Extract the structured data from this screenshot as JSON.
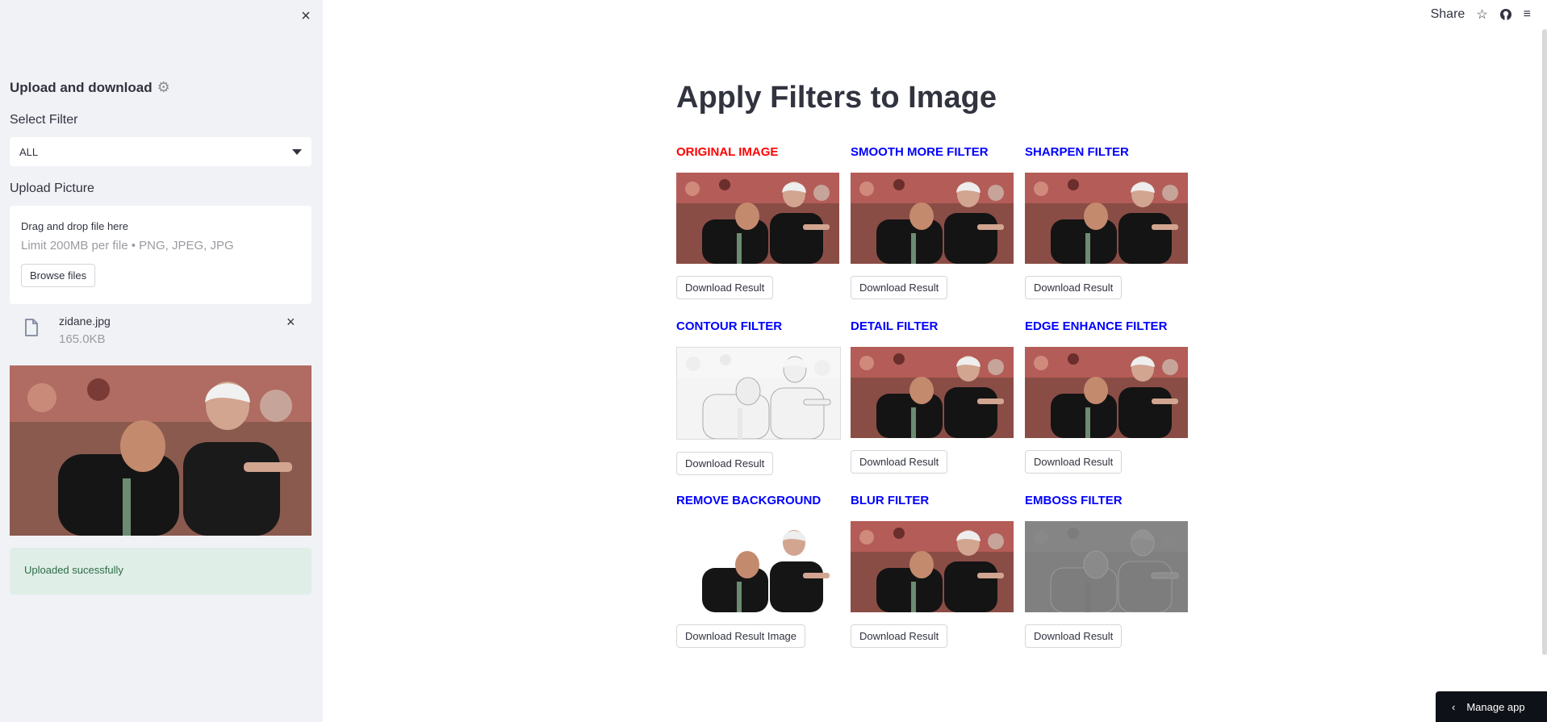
{
  "sidebar": {
    "close_icon": "×",
    "heading": "Upload and download",
    "gear_icon": "⚙",
    "select_label": "Select Filter",
    "select_value": "ALL",
    "upload_label": "Upload Picture",
    "dropzone_title": "Drag and drop file here",
    "dropzone_limit": "Limit 200MB per file • PNG, JPEG, JPG",
    "browse_label": "Browse files",
    "file_name": "zidane.jpg",
    "file_size": "165.0KB",
    "remove_icon": "×",
    "success_text": "Uploaded sucessfully"
  },
  "toolbar": {
    "share_label": "Share",
    "star_icon": "☆",
    "github_icon": "github-icon",
    "menu_icon": "≡"
  },
  "main": {
    "title": "Apply Filters to Image",
    "filters": [
      {
        "title": "ORIGINAL IMAGE",
        "color": "#ff0000",
        "button": "Download Result",
        "style": "photo"
      },
      {
        "title": "SMOOTH MORE FILTER",
        "color": "#0000ff",
        "button": "Download Result",
        "style": "photo"
      },
      {
        "title": "SHARPEN FILTER",
        "color": "#0000ff",
        "button": "Download Result",
        "style": "photo"
      },
      {
        "title": "CONTOUR FILTER",
        "color": "#0000ff",
        "button": "Download Result",
        "style": "contour"
      },
      {
        "title": "DETAIL FILTER",
        "color": "#0000ff",
        "button": "Download Result",
        "style": "photo"
      },
      {
        "title": "EDGE ENHANCE FILTER",
        "color": "#0000ff",
        "button": "Download Result",
        "style": "photo"
      },
      {
        "title": "REMOVE BACKGROUND",
        "color": "#0000ff",
        "button": "Download Result Image",
        "style": "nobg"
      },
      {
        "title": "BLUR FILTER",
        "color": "#0000ff",
        "button": "Download Result",
        "style": "photo"
      },
      {
        "title": "EMBOSS FILTER",
        "color": "#0000ff",
        "button": "Download Result",
        "style": "emboss"
      }
    ]
  },
  "manage_app": {
    "label": "Manage app",
    "chevron_icon": "‹"
  }
}
